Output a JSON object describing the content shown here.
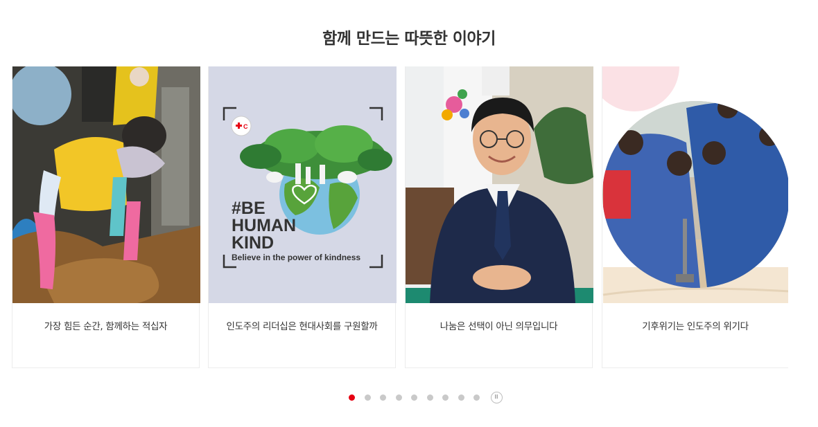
{
  "section": {
    "title": "함께 만드는 따뜻한 이야기"
  },
  "cards": [
    {
      "caption": "가장 힘든 순간, 함께하는 적십자"
    },
    {
      "caption": "인도주의 리더십은 현대사회를 구원할까",
      "poster": {
        "line1": "#BE",
        "line2": "HUMAN",
        "line3": "KIND",
        "tagline": "Believe in the power of kindness"
      }
    },
    {
      "caption": "나눔은 선택이 아닌 의무입니다"
    },
    {
      "caption": "기후위기는 인도주의 위기다"
    }
  ],
  "pagination": {
    "total": 9,
    "active_index": 0,
    "pause_symbol": "II"
  },
  "colors": {
    "accent": "#e60012",
    "dot": "#c9c9c9",
    "title": "#333333"
  }
}
